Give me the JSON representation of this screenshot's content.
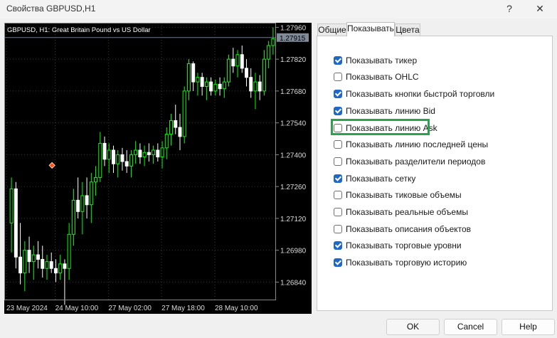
{
  "window": {
    "title": "Свойства GBPUSD,H1",
    "help_glyph": "?",
    "close_glyph": "✕"
  },
  "chart": {
    "caption": "GBPUSD, H1:  Great Britain Pound vs US Dollar",
    "price_labels": [
      "1.27960",
      "1.27820",
      "1.27680",
      "1.27540",
      "1.27400",
      "1.27260",
      "1.27120",
      "1.26980",
      "1.26840"
    ],
    "current_price": "1.27915",
    "time_labels": [
      "23 May 2024",
      "24 May 10:00",
      "27 May 02:00",
      "27 May 18:00",
      "28 May 10:00"
    ]
  },
  "chart_data": {
    "type": "candlestick",
    "symbol": "GBPUSD",
    "timeframe": "H1",
    "ylim": [
      1.2676,
      1.2798
    ],
    "candles": [
      {
        "o": 1.271,
        "h": 1.273,
        "l": 1.2697,
        "c": 1.2725
      },
      {
        "o": 1.2725,
        "h": 1.2728,
        "l": 1.269,
        "c": 1.2695
      },
      {
        "o": 1.2695,
        "h": 1.271,
        "l": 1.2683,
        "c": 1.2688
      },
      {
        "o": 1.2688,
        "h": 1.2702,
        "l": 1.268,
        "c": 1.2698
      },
      {
        "o": 1.2698,
        "h": 1.2704,
        "l": 1.2688,
        "c": 1.2693
      },
      {
        "o": 1.2693,
        "h": 1.27,
        "l": 1.2685,
        "c": 1.2696
      },
      {
        "o": 1.2696,
        "h": 1.2702,
        "l": 1.269,
        "c": 1.2694
      },
      {
        "o": 1.2694,
        "h": 1.27,
        "l": 1.2686,
        "c": 1.269
      },
      {
        "o": 1.269,
        "h": 1.2696,
        "l": 1.2685,
        "c": 1.2693
      },
      {
        "o": 1.2693,
        "h": 1.2697,
        "l": 1.2688,
        "c": 1.269
      },
      {
        "o": 1.269,
        "h": 1.2694,
        "l": 1.2684,
        "c": 1.2688
      },
      {
        "o": 1.2688,
        "h": 1.2696,
        "l": 1.2685,
        "c": 1.2692
      },
      {
        "o": 1.2692,
        "h": 1.2694,
        "l": 1.2674,
        "c": 1.269
      },
      {
        "o": 1.269,
        "h": 1.271,
        "l": 1.2685,
        "c": 1.2705
      },
      {
        "o": 1.2705,
        "h": 1.2725,
        "l": 1.27,
        "c": 1.272
      },
      {
        "o": 1.272,
        "h": 1.273,
        "l": 1.2712,
        "c": 1.2715
      },
      {
        "o": 1.2715,
        "h": 1.2728,
        "l": 1.2705,
        "c": 1.2722
      },
      {
        "o": 1.2722,
        "h": 1.273,
        "l": 1.2712,
        "c": 1.2718
      },
      {
        "o": 1.2718,
        "h": 1.2732,
        "l": 1.271,
        "c": 1.2728
      },
      {
        "o": 1.2728,
        "h": 1.2735,
        "l": 1.2722,
        "c": 1.273
      },
      {
        "o": 1.273,
        "h": 1.275,
        "l": 1.2728,
        "c": 1.2745
      },
      {
        "o": 1.2745,
        "h": 1.2748,
        "l": 1.2735,
        "c": 1.2738
      },
      {
        "o": 1.2738,
        "h": 1.2745,
        "l": 1.2732,
        "c": 1.2742
      },
      {
        "o": 1.2742,
        "h": 1.2744,
        "l": 1.2732,
        "c": 1.2736
      },
      {
        "o": 1.2736,
        "h": 1.2742,
        "l": 1.273,
        "c": 1.274
      },
      {
        "o": 1.274,
        "h": 1.2743,
        "l": 1.2733,
        "c": 1.2737
      },
      {
        "o": 1.2737,
        "h": 1.2742,
        "l": 1.2732,
        "c": 1.2735
      },
      {
        "o": 1.2735,
        "h": 1.2742,
        "l": 1.273,
        "c": 1.274
      },
      {
        "o": 1.274,
        "h": 1.2746,
        "l": 1.2736,
        "c": 1.2742
      },
      {
        "o": 1.2742,
        "h": 1.2745,
        "l": 1.2736,
        "c": 1.2739
      },
      {
        "o": 1.2739,
        "h": 1.2744,
        "l": 1.2735,
        "c": 1.2741
      },
      {
        "o": 1.2741,
        "h": 1.2745,
        "l": 1.2737,
        "c": 1.274
      },
      {
        "o": 1.274,
        "h": 1.2744,
        "l": 1.2736,
        "c": 1.2742
      },
      {
        "o": 1.2742,
        "h": 1.2745,
        "l": 1.2737,
        "c": 1.2739
      },
      {
        "o": 1.2739,
        "h": 1.2746,
        "l": 1.2734,
        "c": 1.2743
      },
      {
        "o": 1.2743,
        "h": 1.2752,
        "l": 1.2738,
        "c": 1.2749
      },
      {
        "o": 1.2749,
        "h": 1.2758,
        "l": 1.2744,
        "c": 1.2755
      },
      {
        "o": 1.2755,
        "h": 1.2762,
        "l": 1.2749,
        "c": 1.2752
      },
      {
        "o": 1.2752,
        "h": 1.2758,
        "l": 1.2742,
        "c": 1.2748
      },
      {
        "o": 1.2748,
        "h": 1.277,
        "l": 1.2745,
        "c": 1.2768
      },
      {
        "o": 1.2768,
        "h": 1.2782,
        "l": 1.2764,
        "c": 1.278
      },
      {
        "o": 1.278,
        "h": 1.2781,
        "l": 1.2768,
        "c": 1.2772
      },
      {
        "o": 1.2772,
        "h": 1.2776,
        "l": 1.2766,
        "c": 1.2774
      },
      {
        "o": 1.2774,
        "h": 1.2776,
        "l": 1.2766,
        "c": 1.277
      },
      {
        "o": 1.277,
        "h": 1.2774,
        "l": 1.2764,
        "c": 1.2772
      },
      {
        "o": 1.2772,
        "h": 1.2774,
        "l": 1.2766,
        "c": 1.2768
      },
      {
        "o": 1.2768,
        "h": 1.2773,
        "l": 1.2766,
        "c": 1.2771
      },
      {
        "o": 1.2771,
        "h": 1.2774,
        "l": 1.2766,
        "c": 1.2769
      },
      {
        "o": 1.2769,
        "h": 1.2774,
        "l": 1.2765,
        "c": 1.2772
      },
      {
        "o": 1.2772,
        "h": 1.2784,
        "l": 1.277,
        "c": 1.2782
      },
      {
        "o": 1.2782,
        "h": 1.2787,
        "l": 1.2776,
        "c": 1.2779
      },
      {
        "o": 1.2779,
        "h": 1.2786,
        "l": 1.2774,
        "c": 1.2784
      },
      {
        "o": 1.2784,
        "h": 1.2788,
        "l": 1.2776,
        "c": 1.2778
      },
      {
        "o": 1.2778,
        "h": 1.2782,
        "l": 1.277,
        "c": 1.2774
      },
      {
        "o": 1.2774,
        "h": 1.2778,
        "l": 1.2765,
        "c": 1.2768
      },
      {
        "o": 1.2768,
        "h": 1.2776,
        "l": 1.276,
        "c": 1.2772
      },
      {
        "o": 1.2772,
        "h": 1.2775,
        "l": 1.2764,
        "c": 1.2768
      },
      {
        "o": 1.2768,
        "h": 1.2786,
        "l": 1.2766,
        "c": 1.2782
      },
      {
        "o": 1.2782,
        "h": 1.279,
        "l": 1.2778,
        "c": 1.2788
      },
      {
        "o": 1.2788,
        "h": 1.2796,
        "l": 1.2784,
        "c": 1.2791
      }
    ],
    "marker": {
      "index": 13,
      "price": 1.2725
    },
    "current_price": 1.27915
  },
  "tabs": [
    {
      "label": "Общие",
      "active": false
    },
    {
      "label": "Показывать",
      "active": true
    },
    {
      "label": "Цвета",
      "active": false
    }
  ],
  "options": [
    {
      "label": "Показывать тикер",
      "checked": true
    },
    {
      "label": "Показывать OHLC",
      "checked": false
    },
    {
      "label": "Показывать кнопки быстрой торговли",
      "checked": true
    },
    {
      "label": "Показывать линию Bid",
      "checked": true
    },
    {
      "label": "Показывать линию Ask",
      "checked": false
    },
    {
      "label": "Показывать линию последней цены",
      "checked": false
    },
    {
      "label": "Показывать разделители периодов",
      "checked": false
    },
    {
      "label": "Показывать сетку",
      "checked": true
    },
    {
      "label": "Показывать тиковые объемы",
      "checked": false
    },
    {
      "label": "Показывать реальные объемы",
      "checked": false
    },
    {
      "label": "Показывать описания объектов",
      "checked": false
    },
    {
      "label": "Показывать торговые уровни",
      "checked": true
    },
    {
      "label": "Показывать торговую историю",
      "checked": true
    }
  ],
  "buttons": {
    "ok": "OK",
    "cancel": "Cancel",
    "help": "Help"
  },
  "colors": {
    "bull": "#00ff00",
    "bear": "#ffffff",
    "grid": "#3a3a3a",
    "checked": "#1f68c6",
    "highlight": "#2aa34a"
  }
}
